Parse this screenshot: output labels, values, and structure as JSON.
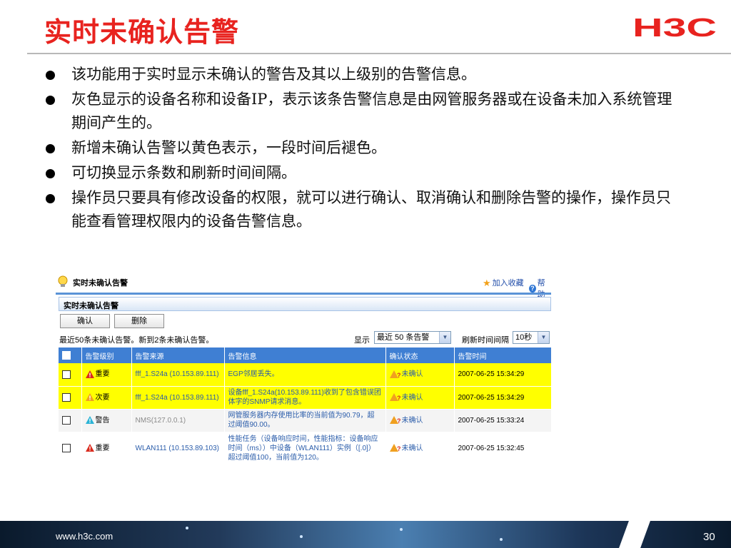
{
  "slide": {
    "title": "实时未确认告警",
    "brand": "H3C",
    "bullets": [
      "该功能用于实时显示未确认的警告及其以上级别的告警信息。",
      "灰色显示的设备名称和设备IP，表示该条告警信息是由网管服务器或在设备未加入系统管理期间产生的。",
      "新增未确认告警以黄色表示，一段时间后褪色。",
      "可切换显示条数和刷新时间间隔。",
      "操作员只要具有修改设备的权限，就可以进行确认、取消确认和删除告警的操作，操作员只能查看管理权限内的设备告警信息。"
    ],
    "footer_url": "www.h3c.com",
    "page_number": "30"
  },
  "window": {
    "title": "实时未确认告警",
    "add_favorite": "加入收藏",
    "help": "帮助",
    "section_title": "实时未确认告警",
    "buttons": {
      "confirm": "确认",
      "delete": "删除"
    },
    "status_text": "最近50条未确认告警。新到2条未确认告警。",
    "show_label": "显示",
    "show_select": "最近 50 条告警",
    "refresh_label": "刷新时间间隔",
    "refresh_select": "10秒",
    "columns": [
      "告警级别",
      "告警来源",
      "告警信息",
      "确认状态",
      "告警时间"
    ],
    "rows": [
      {
        "highlight": "new",
        "level": "重要",
        "level_color": "#d92b1e",
        "source": "fff_1.S24a (10.153.89.111)",
        "source_style": "link",
        "info": "EGP邻居丢失。",
        "status": "未确认",
        "time": "2007-06-25 15:34:29"
      },
      {
        "highlight": "new",
        "level": "次要",
        "level_color": "#f0a020",
        "source": "fff_1.S24a (10.153.89.111)",
        "source_style": "link",
        "info": "设备fff_1.S24a(10.153.89.111)收到了包含错误团体字的SNMP请求消息。",
        "status": "未确认",
        "time": "2007-06-25 15:34:29"
      },
      {
        "highlight": "normal",
        "level": "警告",
        "level_color": "#2bb3d6",
        "source": "NMS(127.0.0.1)",
        "source_style": "gray",
        "info": "网管服务器内存使用比率的当前值为90.79，超过阈值90.00。",
        "status": "未确认",
        "time": "2007-06-25 15:33:24"
      },
      {
        "highlight": "white",
        "level": "重要",
        "level_color": "#d92b1e",
        "source": "WLAN111 (10.153.89.103)",
        "source_style": "link",
        "info": "性能任务（设备响应时间，性能指标：设备响应时间（ms））中设备（WLAN111）实例（[.0]）超过阈值100，当前值为120。",
        "status": "未确认",
        "time": "2007-06-25 15:32:45"
      }
    ]
  },
  "colors": {
    "title_red": "#e8231f",
    "header_blue": "#3f7fd3",
    "new_alarm_yellow": "#ffff00",
    "link_blue": "#2a5caa"
  }
}
